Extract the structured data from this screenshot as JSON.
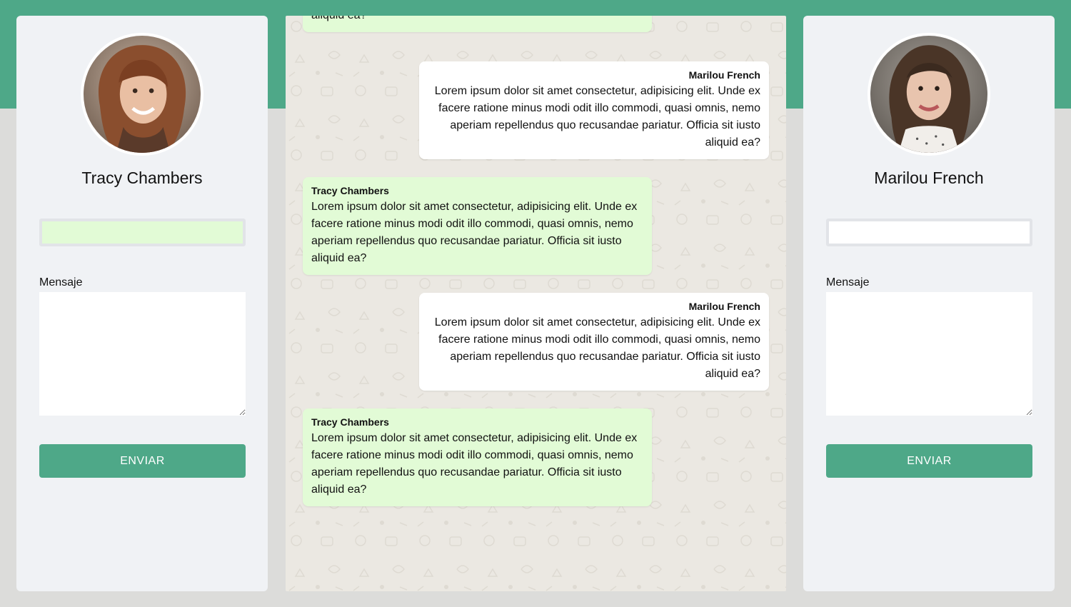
{
  "users": [
    {
      "name": "Tracy Chambers",
      "avatar_alt": "Tracy Chambers avatar",
      "name_input_value": "",
      "message_label": "Mensaje",
      "message_value": "",
      "send_label": "ENVIAR"
    },
    {
      "name": "Marilou French",
      "avatar_alt": "Marilou French avatar",
      "name_input_value": "",
      "message_label": "Mensaje",
      "message_value": "",
      "send_label": "ENVIAR"
    }
  ],
  "chat": {
    "messages": [
      {
        "author": "",
        "text": "aliquid ea?",
        "side": "sent"
      },
      {
        "author": "Marilou French",
        "text": "Lorem ipsum dolor sit amet consectetur, adipisicing elit. Unde ex facere ratione minus modi odit illo commodi, quasi omnis, nemo aperiam repellendus quo recusandae pariatur. Officia sit iusto aliquid ea?",
        "side": "recv"
      },
      {
        "author": "Tracy Chambers",
        "text": "Lorem ipsum dolor sit amet consectetur, adipisicing elit. Unde ex facere ratione minus modi odit illo commodi, quasi omnis, nemo aperiam repellendus quo recusandae pariatur. Officia sit iusto aliquid ea?",
        "side": "sent"
      },
      {
        "author": "Marilou French",
        "text": "Lorem ipsum dolor sit amet consectetur, adipisicing elit. Unde ex facere ratione minus modi odit illo commodi, quasi omnis, nemo aperiam repellendus quo recusandae pariatur. Officia sit iusto aliquid ea?",
        "side": "recv"
      },
      {
        "author": "Tracy Chambers",
        "text": "Lorem ipsum dolor sit amet consectetur, adipisicing elit. Unde ex facere ratione minus modi odit illo commodi, quasi omnis, nemo aperiam repellendus quo recusandae pariatur. Officia sit iusto aliquid ea?",
        "side": "sent"
      }
    ]
  },
  "colors": {
    "accent": "#4ea888",
    "sent_bubble": "#e2fbd6",
    "received_bubble": "#ffffff",
    "panel_bg": "#f0f2f5",
    "chat_bg": "#ebe8e2"
  }
}
